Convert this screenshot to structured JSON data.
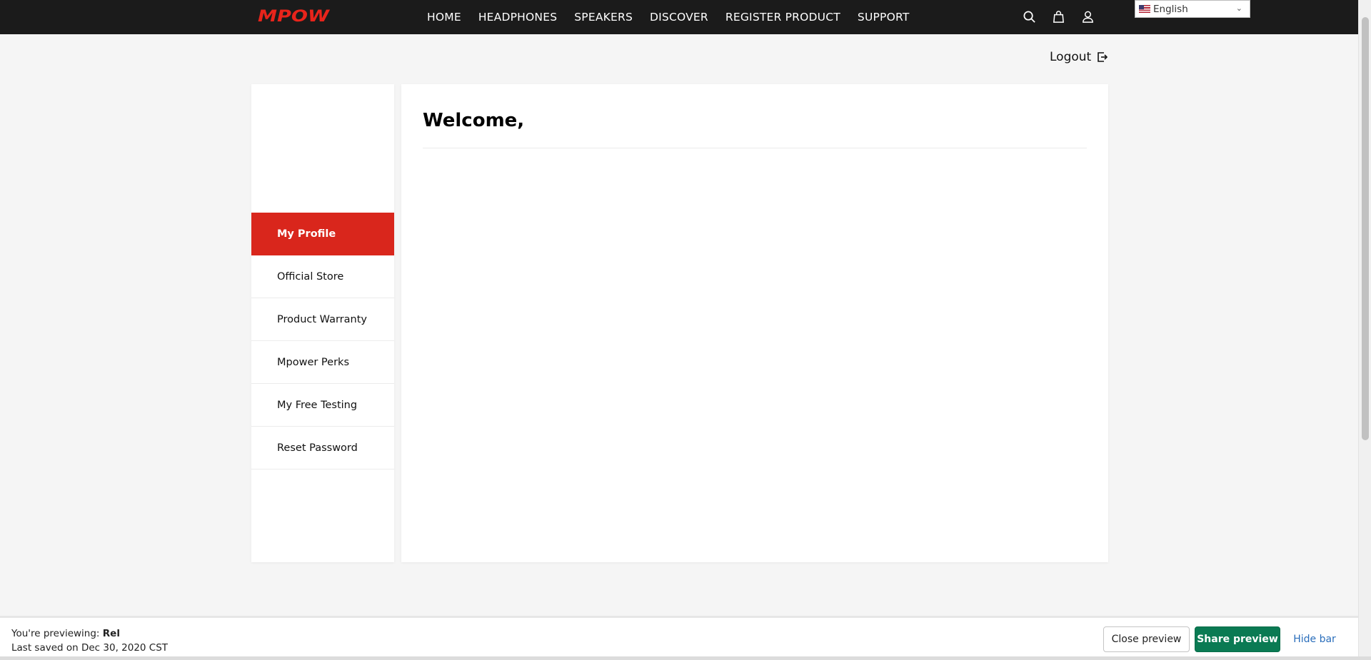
{
  "header": {
    "logo_text": "MPOW",
    "brand_color": "#e8241b",
    "nav": [
      "HOME",
      "HEADPHONES",
      "SPEAKERS",
      "DISCOVER",
      "REGISTER PRODUCT",
      "SUPPORT"
    ],
    "icons": [
      "search-icon",
      "cart-icon",
      "user-icon"
    ],
    "language": "English"
  },
  "account": {
    "logout_label": "Logout",
    "sidebar": {
      "items": [
        {
          "label": "My Profile",
          "active": true
        },
        {
          "label": "Official Store"
        },
        {
          "label": "Product Warranty"
        },
        {
          "label": "Mpower Perks"
        },
        {
          "label": "My Free Testing"
        },
        {
          "label": "Reset Password"
        }
      ],
      "active_color": "#d9261c"
    },
    "welcome_title": "Welcome,"
  },
  "preview_bar": {
    "previewing_prefix": "You're previewing: ",
    "previewing_name": "Rel",
    "last_saved": "Last saved on Dec 30, 2020 CST",
    "close_label": "Close preview",
    "share_label": "Share preview",
    "hide_label": "Hide bar",
    "share_color": "#0a7a53"
  }
}
